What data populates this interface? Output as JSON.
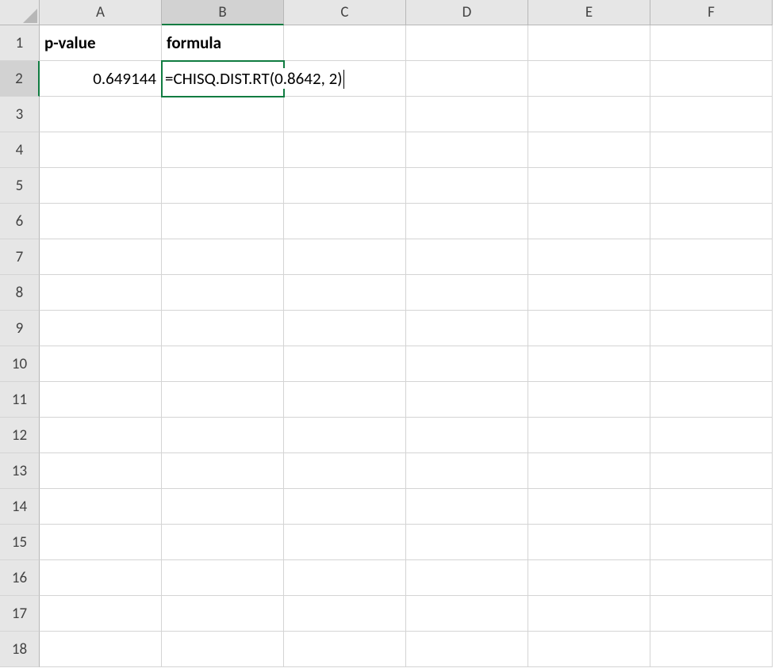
{
  "columns": [
    "A",
    "B",
    "C",
    "D",
    "E",
    "F"
  ],
  "rowCount": 18,
  "activeCell": "B2",
  "cells": {
    "A1": "p-value",
    "B1": "formula",
    "A2": "0.649144",
    "B2": "=CHISQ.DIST.RT(0.8642, 2)"
  },
  "colors": {
    "selection": "#107c41",
    "headerBg": "#e6e6e6",
    "gridLine": "#d4d4d4"
  }
}
